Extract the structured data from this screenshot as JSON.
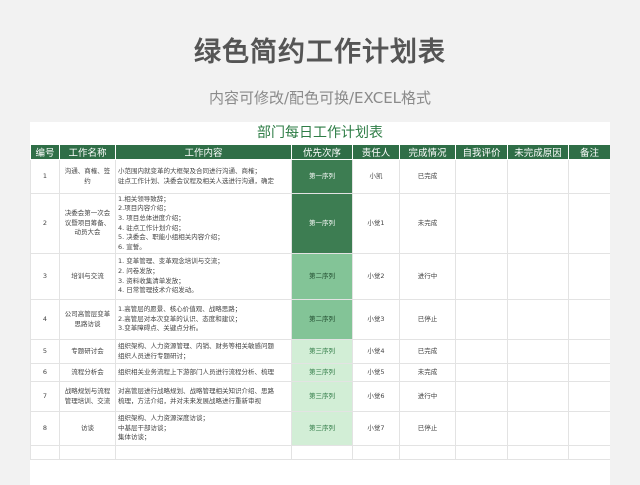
{
  "title": "绿色简约工作计划表",
  "subtitle": "内容可修改/配色可换/EXCEL格式",
  "sheet_title": "部门每日工作计划表",
  "headers": [
    "编号",
    "工作名称",
    "工作内容",
    "优先次序",
    "责任人",
    "完成情况",
    "自我评价",
    "未完成原因",
    "备注"
  ],
  "colors": {
    "header": "#2f6e47",
    "priority1": "#3d7d52",
    "priority2": "#83c497",
    "priority3": "#d2eed6"
  },
  "rows": [
    {
      "id": "1",
      "name": [
        "沟通、商榷、签",
        "约"
      ],
      "content": [
        "小范围内就变革的大框架及合同进行沟通、商榷；",
        "驻点工作计划、决委会议程及相关人选进行沟通，确定"
      ],
      "priority": "第一序列",
      "plevel": 1,
      "owner": "小凯",
      "status": "已完成",
      "h": 34
    },
    {
      "id": "2",
      "name": [
        "决委会第一次会",
        "议暨项目筹备、",
        "动员大会"
      ],
      "content": [
        "1.相关领导致辞；",
        "2.项目内容介绍；",
        "3. 项目总体进度介绍；",
        "4. 驻点工作计划介绍；",
        "5. 决委会、职能小组相关内容介绍；",
        "6. 宣誓。"
      ],
      "priority": "第一序列",
      "plevel": 1,
      "owner": "小觉1",
      "status": "未完成",
      "h": 60
    },
    {
      "id": "3",
      "name": [
        "培训与交流"
      ],
      "content": [
        "1. 变革管理、变革观念培训与交流；",
        "2. 问卷发放；",
        "3. 资料收集清单发放；",
        "4. 日常管理技术介绍发动。"
      ],
      "priority": "第二序列",
      "plevel": 2,
      "owner": "小觉2",
      "status": "进行中",
      "h": 46
    },
    {
      "id": "4",
      "name": [
        "公司高管层变革",
        "思路访谈"
      ],
      "content": [
        "1.高管层的愿景、核心价值观、战略思路；",
        "2.高管层对本次变革的认识、态度和建议；",
        "3.变革障碍点、关键点分析。"
      ],
      "priority": "第二序列",
      "plevel": 2,
      "owner": "小觉3",
      "status": "已停止",
      "h": 40
    },
    {
      "id": "5",
      "name": [
        "专题研讨会"
      ],
      "content": [
        "组织架构、人力资源管理、内销、财务等相关敏感问题",
        "组织人员进行专题研讨；"
      ],
      "priority": "第三序列",
      "plevel": 3,
      "owner": "小觉4",
      "status": "已完成",
      "h": 24
    },
    {
      "id": "6",
      "name": [
        "流程分析会"
      ],
      "content": [
        "组织相关业务流程上下游部门人员进行流程分析、梳理"
      ],
      "priority": "第三序列",
      "plevel": 3,
      "owner": "小觉5",
      "status": "未完成",
      "h": 18
    },
    {
      "id": "7",
      "name": [
        "战略规划与流程",
        "管理培训、交流"
      ],
      "content": [
        "对高管层进行战略规划、战略管理相关知识介绍、思路",
        "梳理，方法介绍，并对未来发展战略进行重新审视"
      ],
      "priority": "第三序列",
      "plevel": 3,
      "owner": "小觉6",
      "status": "进行中",
      "h": 30
    },
    {
      "id": "8",
      "name": [
        "访谈"
      ],
      "content": [
        "组织架构、人力资源深度访谈；",
        "中基层干部访谈；",
        "集体访谈；"
      ],
      "priority": "第三序列",
      "plevel": 3,
      "owner": "小觉7",
      "status": "已停止",
      "h": 34
    },
    {
      "id": "",
      "name": [
        ""
      ],
      "content": [
        ""
      ],
      "priority": "",
      "plevel": 0,
      "owner": "",
      "status": "",
      "h": 14
    }
  ]
}
